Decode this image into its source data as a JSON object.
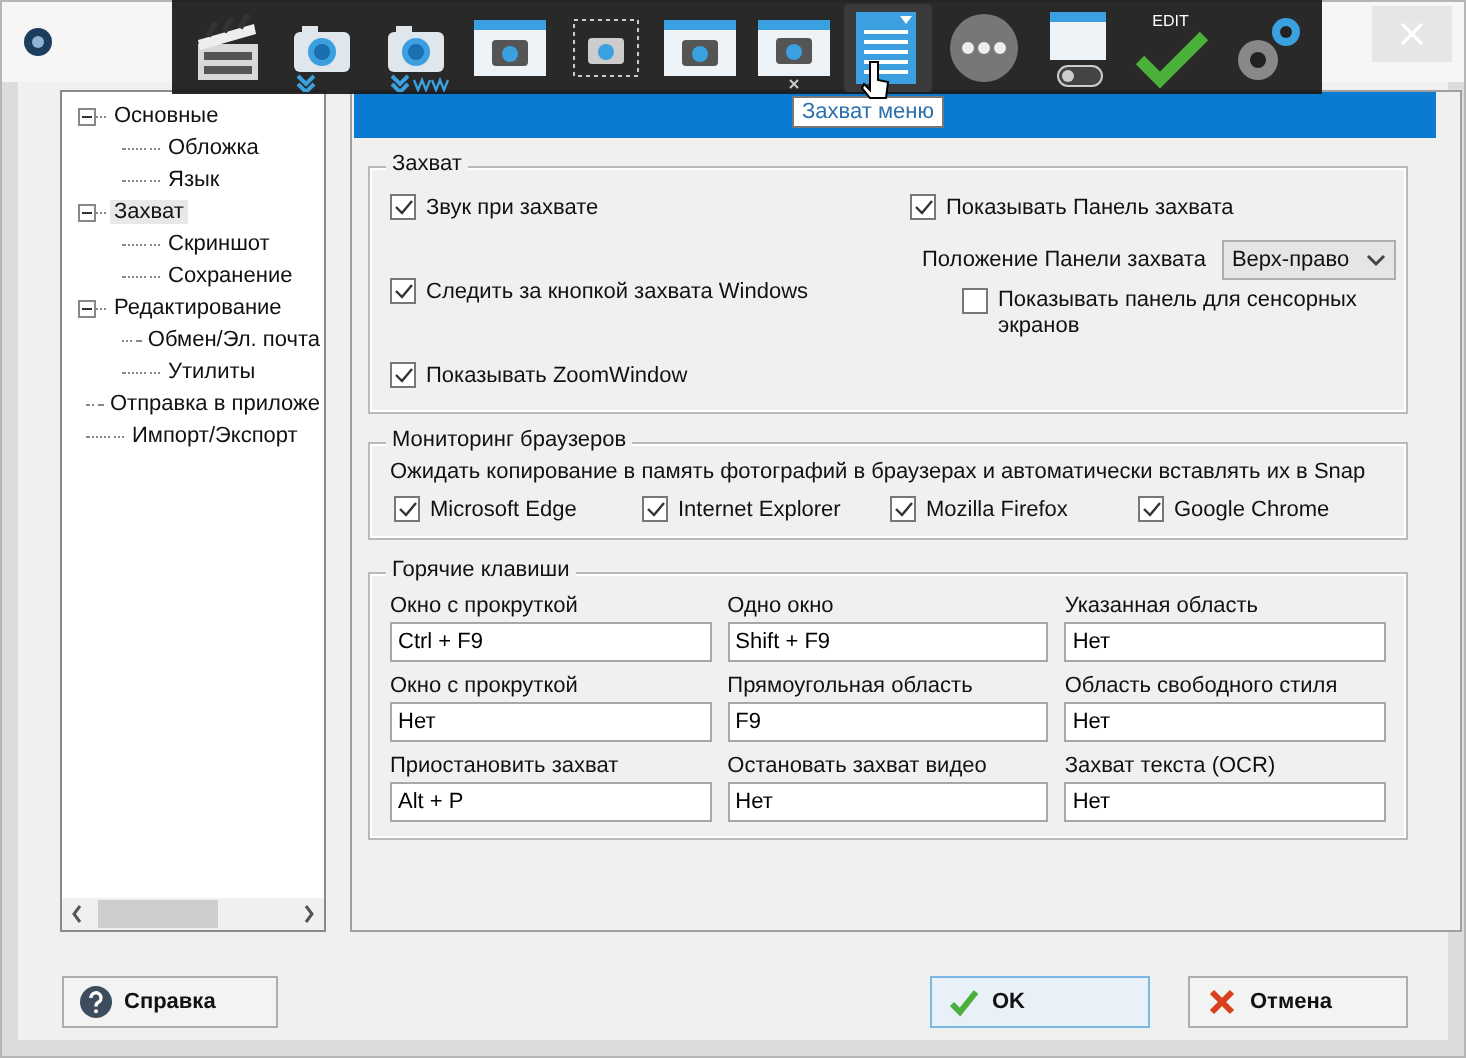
{
  "toolbar": {
    "tooltip": "Захват меню",
    "items": [
      {
        "kind": "video",
        "hovered": false
      },
      {
        "kind": "camera-down",
        "hovered": false
      },
      {
        "kind": "camera-www",
        "hovered": false
      },
      {
        "kind": "window-camera",
        "hovered": false
      },
      {
        "kind": "region-camera",
        "hovered": false
      },
      {
        "kind": "scroll-camera",
        "hovered": false
      },
      {
        "kind": "window-camera-x",
        "hovered": false
      },
      {
        "kind": "menu",
        "hovered": true
      },
      {
        "kind": "more",
        "hovered": false
      },
      {
        "kind": "toggle-window",
        "hovered": false
      },
      {
        "kind": "edit",
        "label": "EDIT",
        "hovered": false
      },
      {
        "kind": "gears",
        "hovered": false
      }
    ]
  },
  "sidebar": {
    "items": [
      {
        "label": "Основные",
        "expanded": true,
        "selected": false,
        "children": [
          {
            "label": "Обложка",
            "selected": false
          },
          {
            "label": "Язык",
            "selected": false
          }
        ]
      },
      {
        "label": "Захват",
        "expanded": true,
        "selected": true,
        "children": [
          {
            "label": "Скриншот",
            "selected": false
          },
          {
            "label": "Сохранение",
            "selected": false
          }
        ]
      },
      {
        "label": "Редактирование",
        "expanded": true,
        "selected": false,
        "children": [
          {
            "label": "Обмен/Эл. почта",
            "selected": false
          },
          {
            "label": "Утилиты",
            "selected": false
          }
        ]
      },
      {
        "label": "Отправка в приложе",
        "selected": false
      },
      {
        "label": "Импорт/Экспорт",
        "selected": false
      }
    ]
  },
  "capture": {
    "title": "Захват",
    "left_options": [
      {
        "label": "Звук при захвате",
        "checked": true
      },
      {
        "label": "Следить за кнопкой захвата Windows",
        "checked": true
      },
      {
        "label": "Показывать ZoomWindow",
        "checked": true
      }
    ],
    "show_panel": {
      "label": "Показывать Панель захвата",
      "checked": true
    },
    "position": {
      "label": "Положение Панели захвата",
      "value": "Верх-право"
    },
    "touch": {
      "label": "Показывать панель для сенсорных экранов",
      "checked": false
    }
  },
  "browsers": {
    "title": "Мониторинг браузеров",
    "description": "Ожидать копирование в память фотографий в браузерах и автоматически вставлять их в Snap",
    "items": [
      {
        "label": "Microsoft Edge",
        "checked": true
      },
      {
        "label": "Internet Explorer",
        "checked": true
      },
      {
        "label": "Mozilla Firefox",
        "checked": true
      },
      {
        "label": "Google Chrome",
        "checked": true
      }
    ]
  },
  "hotkeys": {
    "title": "Горячие клавиши",
    "fields": [
      {
        "label": "Окно с прокруткой",
        "value": "Ctrl + F9"
      },
      {
        "label": "Одно окно",
        "value": "Shift + F9"
      },
      {
        "label": "Указанная область",
        "value": "Нет"
      },
      {
        "label": "Окно с прокруткой",
        "value": "Нет"
      },
      {
        "label": "Прямоугольная область",
        "value": "F9"
      },
      {
        "label": "Область свободного стиля",
        "value": "Нет"
      },
      {
        "label": "Приостановить захват",
        "value": "Alt + P"
      },
      {
        "label": "Остановать захват видео",
        "value": "Нет"
      },
      {
        "label": "Захват текста (OCR)",
        "value": "Нет"
      }
    ]
  },
  "buttons": [
    {
      "kind": "help",
      "label": "Справка",
      "default": false
    },
    {
      "kind": "ok",
      "label": "OK",
      "default": true
    },
    {
      "kind": "cancel",
      "label": "Отмена",
      "default": false
    }
  ]
}
